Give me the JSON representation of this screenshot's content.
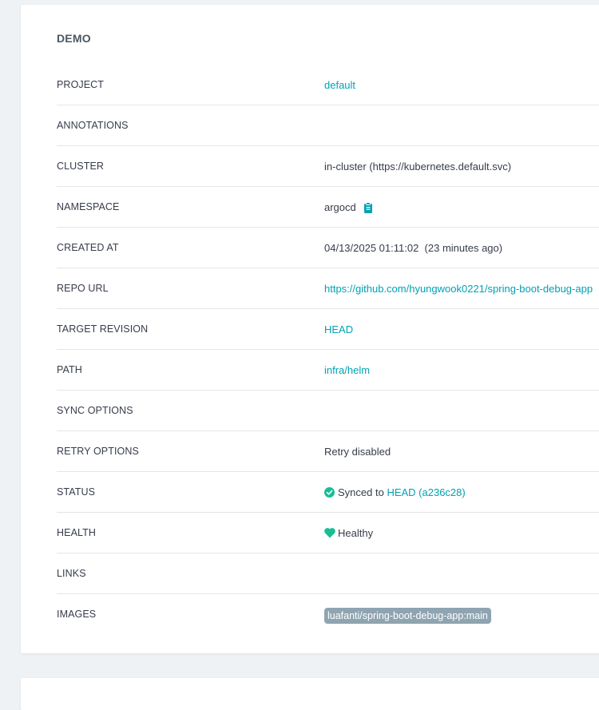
{
  "app": {
    "title": "DEMO"
  },
  "colors": {
    "link": "#00a2b3",
    "success": "#18be94",
    "image_tag_bg": "#8fa4b1"
  },
  "rows": {
    "project": {
      "label": "PROJECT",
      "value": "default"
    },
    "annotations": {
      "label": "ANNOTATIONS",
      "value": ""
    },
    "cluster": {
      "label": "CLUSTER",
      "value": "in-cluster (https://kubernetes.default.svc)"
    },
    "namespace": {
      "label": "NAMESPACE",
      "value": "argocd",
      "icon": "clipboard-icon"
    },
    "created_at": {
      "label": "CREATED AT",
      "value": "04/13/2025 01:11:02  (23 minutes ago)"
    },
    "repo_url": {
      "label": "REPO URL",
      "value": "https://github.com/hyungwook0221/spring-boot-debug-app"
    },
    "target_revision": {
      "label": "TARGET REVISION",
      "value": "HEAD"
    },
    "path": {
      "label": "PATH",
      "value": "infra/helm"
    },
    "sync_options": {
      "label": "SYNC OPTIONS",
      "value": ""
    },
    "retry_options": {
      "label": "RETRY OPTIONS",
      "value": "Retry disabled"
    },
    "status": {
      "label": "STATUS",
      "icon": "check-circle-icon",
      "text": "Synced to",
      "link": "HEAD (a236c28)"
    },
    "health": {
      "label": "HEALTH",
      "icon": "heart-icon",
      "value": "Healthy"
    },
    "links": {
      "label": "LINKS",
      "value": ""
    },
    "images": {
      "label": "IMAGES",
      "value": "luafanti/spring-boot-debug-app:main"
    }
  }
}
